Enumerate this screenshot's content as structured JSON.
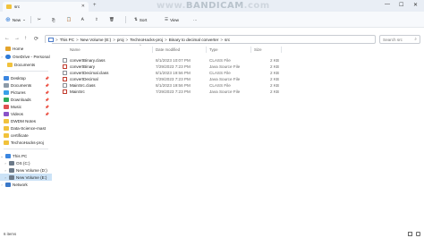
{
  "window": {
    "tab_title": "src",
    "tab_close": "✕",
    "tab_add": "+",
    "minimize": "—",
    "maximize": "☐",
    "close": "✕"
  },
  "watermark": {
    "part1": "www.",
    "part2": "BANDICAM",
    "part3": ".com"
  },
  "toolbar": {
    "new_label": "New",
    "new_chevron": "⌄",
    "cut_icon": "✂",
    "copy_icon": "⎘",
    "paste_icon": "📋",
    "rename_icon": "Ａ",
    "share_icon": "⇪",
    "delete_icon": "🗑",
    "sort_label": "Sort",
    "view_label": "View",
    "more_label": "···"
  },
  "address": {
    "back": "←",
    "forward": "→",
    "up": "↑",
    "refresh": "⟳",
    "crumbs": [
      "This PC",
      "New Volume (E:)",
      "proj",
      "TechnoHacks-proj",
      "Binary to decimal converter",
      "src"
    ],
    "separator": ">",
    "search_placeholder": "Search src",
    "search_icon": "⌕"
  },
  "sidebar": {
    "items": [
      {
        "label": "Home",
        "chev": ""
      },
      {
        "label": "OneDrive - Personal",
        "chev": "›"
      },
      {
        "label": "Documents",
        "chev": ""
      },
      {
        "label": "Desktop",
        "chev": ""
      },
      {
        "label": "Documents",
        "chev": ""
      },
      {
        "label": "Pictures",
        "chev": ""
      },
      {
        "label": "Downloads",
        "chev": ""
      },
      {
        "label": "Music",
        "chev": ""
      },
      {
        "label": "Videos",
        "chev": ""
      },
      {
        "label": "DWDM Notes",
        "chev": ""
      },
      {
        "label": "Data-Science-mast",
        "chev": ""
      },
      {
        "label": "certificate",
        "chev": ""
      },
      {
        "label": "TechnoHacks-proj",
        "chev": ""
      },
      {
        "label": "This PC",
        "chev": "⌄"
      },
      {
        "label": "OS (C:)",
        "chev": "›"
      },
      {
        "label": "New Volume (D:)",
        "chev": "›"
      },
      {
        "label": "New Volume (E:)",
        "chev": "›"
      },
      {
        "label": "Network",
        "chev": "›"
      }
    ],
    "pin": "📌",
    "colors": {
      "home": "#e3a32b",
      "onedrive": "#2f7bd8",
      "folder": "#f1c23b",
      "desktop": "#3a86e0",
      "pictures": "#3aa0e8",
      "downloads": "#2eaa5a",
      "music": "#e05050",
      "videos": "#8a52c8",
      "drive": "#6c7a89",
      "network": "#3a78c8"
    }
  },
  "columns": {
    "name": "Name",
    "date": "Date modified",
    "type": "Type",
    "size": "Size",
    "sort_caret": "^"
  },
  "files": [
    {
      "name": "convertBinary.class",
      "date": "8/1/2023 10:07 PM",
      "type": "CLASS File",
      "size": "2 KB",
      "kind": "class"
    },
    {
      "name": "convertBinary",
      "date": "7/29/2023 7:23 PM",
      "type": "Java Source File",
      "size": "2 KB",
      "kind": "java"
    },
    {
      "name": "convertDecimal.class",
      "date": "8/1/2023 19:56 PM",
      "type": "CLASS File",
      "size": "2 KB",
      "kind": "class"
    },
    {
      "name": "convertDecimal",
      "date": "7/29/2023 7:23 PM",
      "type": "Java Source File",
      "size": "2 KB",
      "kind": "java"
    },
    {
      "name": "MainSrc.class",
      "date": "8/1/2023 19:56 PM",
      "type": "CLASS File",
      "size": "2 KB",
      "kind": "class"
    },
    {
      "name": "MainSrc",
      "date": "7/29/2023 7:23 PM",
      "type": "Java Source File",
      "size": "2 KB",
      "kind": "java"
    }
  ],
  "status": {
    "text": "6 items"
  }
}
